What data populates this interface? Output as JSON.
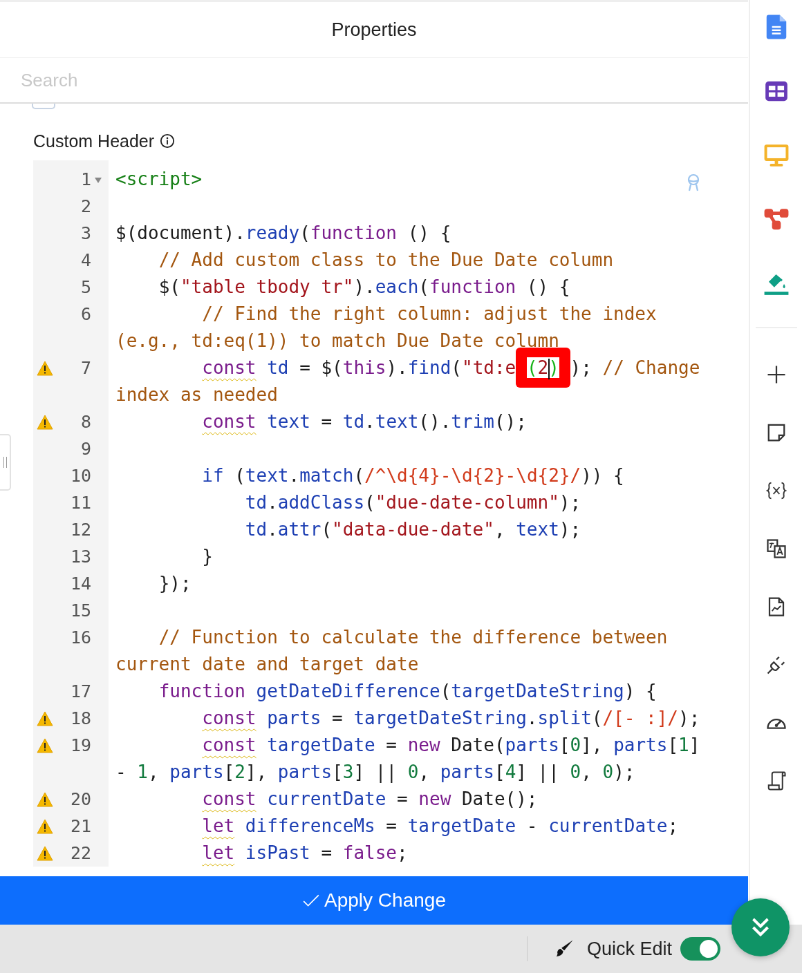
{
  "panel": {
    "title": "Properties"
  },
  "search": {
    "placeholder": "Search"
  },
  "hidden_option": {
    "checked": false
  },
  "field": {
    "label": "Custom Header"
  },
  "editor": {
    "lines": [
      {
        "number": "1",
        "fold": true,
        "warning": false,
        "tokens": [
          {
            "kind": "tag",
            "text": "<script>"
          }
        ]
      },
      {
        "number": "2",
        "fold": false,
        "warning": false
      },
      {
        "number": "3",
        "fold": false,
        "warning": false,
        "tokens": [
          {
            "kind": "plain",
            "text": "$(document)."
          },
          {
            "kind": "var",
            "text": "ready"
          },
          {
            "kind": "plain",
            "text": "("
          },
          {
            "kind": "kw",
            "text": "function"
          },
          {
            "kind": "plain",
            "text": " () {"
          }
        ]
      },
      {
        "number": "4",
        "fold": false,
        "warning": false,
        "tokens": [
          {
            "kind": "com",
            "text": "    // Add custom class to the Due Date column"
          }
        ]
      },
      {
        "number": "5",
        "fold": false,
        "warning": false,
        "tokens": [
          {
            "kind": "plain",
            "text": "    $("
          },
          {
            "kind": "str",
            "text": "\"table tbody tr\""
          },
          {
            "kind": "plain",
            "text": ")."
          },
          {
            "kind": "var",
            "text": "each"
          },
          {
            "kind": "plain",
            "text": "("
          },
          {
            "kind": "kw",
            "text": "function"
          },
          {
            "kind": "plain",
            "text": " () {"
          }
        ]
      },
      {
        "number": "6",
        "fold": false,
        "warning": false,
        "tokens": [
          {
            "kind": "com",
            "text": "        // Find the right column: adjust the index (e.g., td:eq(1)) to match Due Date column"
          }
        ]
      },
      {
        "number": "7",
        "fold": false,
        "warning": true,
        "tokens": [
          {
            "kind": "decl",
            "text": "        const"
          },
          {
            "kind": "var",
            "text": " td"
          },
          {
            "kind": "plain",
            "text": " = $("
          },
          {
            "kind": "kw",
            "text": "this"
          },
          {
            "kind": "plain",
            "text": ")."
          },
          {
            "kind": "var",
            "text": "find"
          },
          {
            "kind": "plain",
            "text": "("
          },
          {
            "kind": "str",
            "text": "\"td:e"
          },
          {
            "kind": "annot",
            "parts": [
              {
                "kind": "bracket",
                "text": "("
              },
              {
                "kind": "str",
                "text": "2"
              },
              {
                "kind": "cursor"
              },
              {
                "kind": "bracket",
                "text": ")"
              }
            ]
          },
          {
            "kind": "plain",
            "text": "); "
          },
          {
            "kind": "com",
            "text": "// Change index as needed"
          }
        ]
      },
      {
        "number": "8",
        "fold": false,
        "warning": true,
        "tokens": [
          {
            "kind": "decl",
            "text": "        const"
          },
          {
            "kind": "var",
            "text": " text"
          },
          {
            "kind": "plain",
            "text": " = "
          },
          {
            "kind": "var",
            "text": "td"
          },
          {
            "kind": "plain",
            "text": "."
          },
          {
            "kind": "var",
            "text": "text"
          },
          {
            "kind": "plain",
            "text": "()."
          },
          {
            "kind": "var",
            "text": "trim"
          },
          {
            "kind": "plain",
            "text": "();"
          }
        ]
      },
      {
        "number": "9",
        "fold": false,
        "warning": false
      },
      {
        "number": "10",
        "fold": false,
        "warning": false,
        "tokens": [
          {
            "kind": "var",
            "text": "        if"
          },
          {
            "kind": "plain",
            "text": " ("
          },
          {
            "kind": "var",
            "text": "text"
          },
          {
            "kind": "plain",
            "text": "."
          },
          {
            "kind": "var",
            "text": "match"
          },
          {
            "kind": "plain",
            "text": "("
          },
          {
            "kind": "re",
            "text": "/^\\d{4}-\\d{2}-\\d{2}/"
          },
          {
            "kind": "plain",
            "text": ")) {"
          }
        ]
      },
      {
        "number": "11",
        "fold": false,
        "warning": false,
        "tokens": [
          {
            "kind": "var",
            "text": "            td"
          },
          {
            "kind": "plain",
            "text": "."
          },
          {
            "kind": "var",
            "text": "addClass"
          },
          {
            "kind": "plain",
            "text": "("
          },
          {
            "kind": "str",
            "text": "\"due-date-column\""
          },
          {
            "kind": "plain",
            "text": ");"
          }
        ]
      },
      {
        "number": "12",
        "fold": false,
        "warning": false,
        "tokens": [
          {
            "kind": "var",
            "text": "            td"
          },
          {
            "kind": "plain",
            "text": "."
          },
          {
            "kind": "var",
            "text": "attr"
          },
          {
            "kind": "plain",
            "text": "("
          },
          {
            "kind": "str",
            "text": "\"data-due-date\""
          },
          {
            "kind": "plain",
            "text": ", "
          },
          {
            "kind": "var",
            "text": "text"
          },
          {
            "kind": "plain",
            "text": ");"
          }
        ]
      },
      {
        "number": "13",
        "fold": false,
        "warning": false,
        "tokens": [
          {
            "kind": "plain",
            "text": "        }"
          }
        ]
      },
      {
        "number": "14",
        "fold": false,
        "warning": false,
        "tokens": [
          {
            "kind": "plain",
            "text": "    });"
          }
        ]
      },
      {
        "number": "15",
        "fold": false,
        "warning": false
      },
      {
        "number": "16",
        "fold": false,
        "warning": false,
        "tokens": [
          {
            "kind": "com",
            "text": "    // Function to calculate the difference between current date and target date"
          }
        ]
      },
      {
        "number": "17",
        "fold": false,
        "warning": false,
        "tokens": [
          {
            "kind": "kw",
            "text": "    function"
          },
          {
            "kind": "var",
            "text": " getDateDifference"
          },
          {
            "kind": "plain",
            "text": "("
          },
          {
            "kind": "var",
            "text": "targetDateString"
          },
          {
            "kind": "plain",
            "text": ") {"
          }
        ]
      },
      {
        "number": "18",
        "fold": false,
        "warning": true,
        "tokens": [
          {
            "kind": "decl",
            "text": "        const"
          },
          {
            "kind": "var",
            "text": " parts"
          },
          {
            "kind": "plain",
            "text": " = "
          },
          {
            "kind": "var",
            "text": "targetDateString"
          },
          {
            "kind": "plain",
            "text": "."
          },
          {
            "kind": "var",
            "text": "split"
          },
          {
            "kind": "plain",
            "text": "("
          },
          {
            "kind": "re",
            "text": "/[- :]/"
          },
          {
            "kind": "plain",
            "text": ");"
          }
        ]
      },
      {
        "number": "19",
        "fold": false,
        "warning": true,
        "tokens": [
          {
            "kind": "decl",
            "text": "        const"
          },
          {
            "kind": "var",
            "text": " targetDate"
          },
          {
            "kind": "plain",
            "text": " = "
          },
          {
            "kind": "kw",
            "text": "new"
          },
          {
            "kind": "plain",
            "text": " Date("
          },
          {
            "kind": "var",
            "text": "parts"
          },
          {
            "kind": "plain",
            "text": "["
          },
          {
            "kind": "num",
            "text": "0"
          },
          {
            "kind": "plain",
            "text": "], "
          },
          {
            "kind": "var",
            "text": "parts"
          },
          {
            "kind": "plain",
            "text": "["
          },
          {
            "kind": "num",
            "text": "1"
          },
          {
            "kind": "plain",
            "text": "] - "
          },
          {
            "kind": "num",
            "text": "1"
          },
          {
            "kind": "plain",
            "text": ", "
          },
          {
            "kind": "var",
            "text": "parts"
          },
          {
            "kind": "plain",
            "text": "["
          },
          {
            "kind": "num",
            "text": "2"
          },
          {
            "kind": "plain",
            "text": "], "
          },
          {
            "kind": "var",
            "text": "parts"
          },
          {
            "kind": "plain",
            "text": "["
          },
          {
            "kind": "num",
            "text": "3"
          },
          {
            "kind": "plain",
            "text": "] || "
          },
          {
            "kind": "num",
            "text": "0"
          },
          {
            "kind": "plain",
            "text": ", "
          },
          {
            "kind": "var",
            "text": "parts"
          },
          {
            "kind": "plain",
            "text": "["
          },
          {
            "kind": "num",
            "text": "4"
          },
          {
            "kind": "plain",
            "text": "] || "
          },
          {
            "kind": "num",
            "text": "0"
          },
          {
            "kind": "plain",
            "text": ", "
          },
          {
            "kind": "num",
            "text": "0"
          },
          {
            "kind": "plain",
            "text": ");"
          }
        ]
      },
      {
        "number": "20",
        "fold": false,
        "warning": true,
        "tokens": [
          {
            "kind": "decl",
            "text": "        const"
          },
          {
            "kind": "var",
            "text": " currentDate"
          },
          {
            "kind": "plain",
            "text": " = "
          },
          {
            "kind": "kw",
            "text": "new"
          },
          {
            "kind": "plain",
            "text": " Date();"
          }
        ]
      },
      {
        "number": "21",
        "fold": false,
        "warning": true,
        "tokens": [
          {
            "kind": "decl",
            "text": "        let"
          },
          {
            "kind": "var",
            "text": " differenceMs"
          },
          {
            "kind": "plain",
            "text": " = "
          },
          {
            "kind": "var",
            "text": "targetDate"
          },
          {
            "kind": "plain",
            "text": " - "
          },
          {
            "kind": "var",
            "text": "currentDate"
          },
          {
            "kind": "plain",
            "text": ";"
          }
        ]
      },
      {
        "number": "22",
        "fold": false,
        "warning": true,
        "tokens": [
          {
            "kind": "decl",
            "text": "        let"
          },
          {
            "kind": "var",
            "text": " isPast"
          },
          {
            "kind": "plain",
            "text": " = "
          },
          {
            "kind": "kw",
            "text": "false"
          },
          {
            "kind": "plain",
            "text": ";"
          }
        ]
      }
    ]
  },
  "apply_button": {
    "label": "Apply Change"
  },
  "footer": {
    "quick_edit": {
      "label": "Quick Edit",
      "on": true
    }
  }
}
